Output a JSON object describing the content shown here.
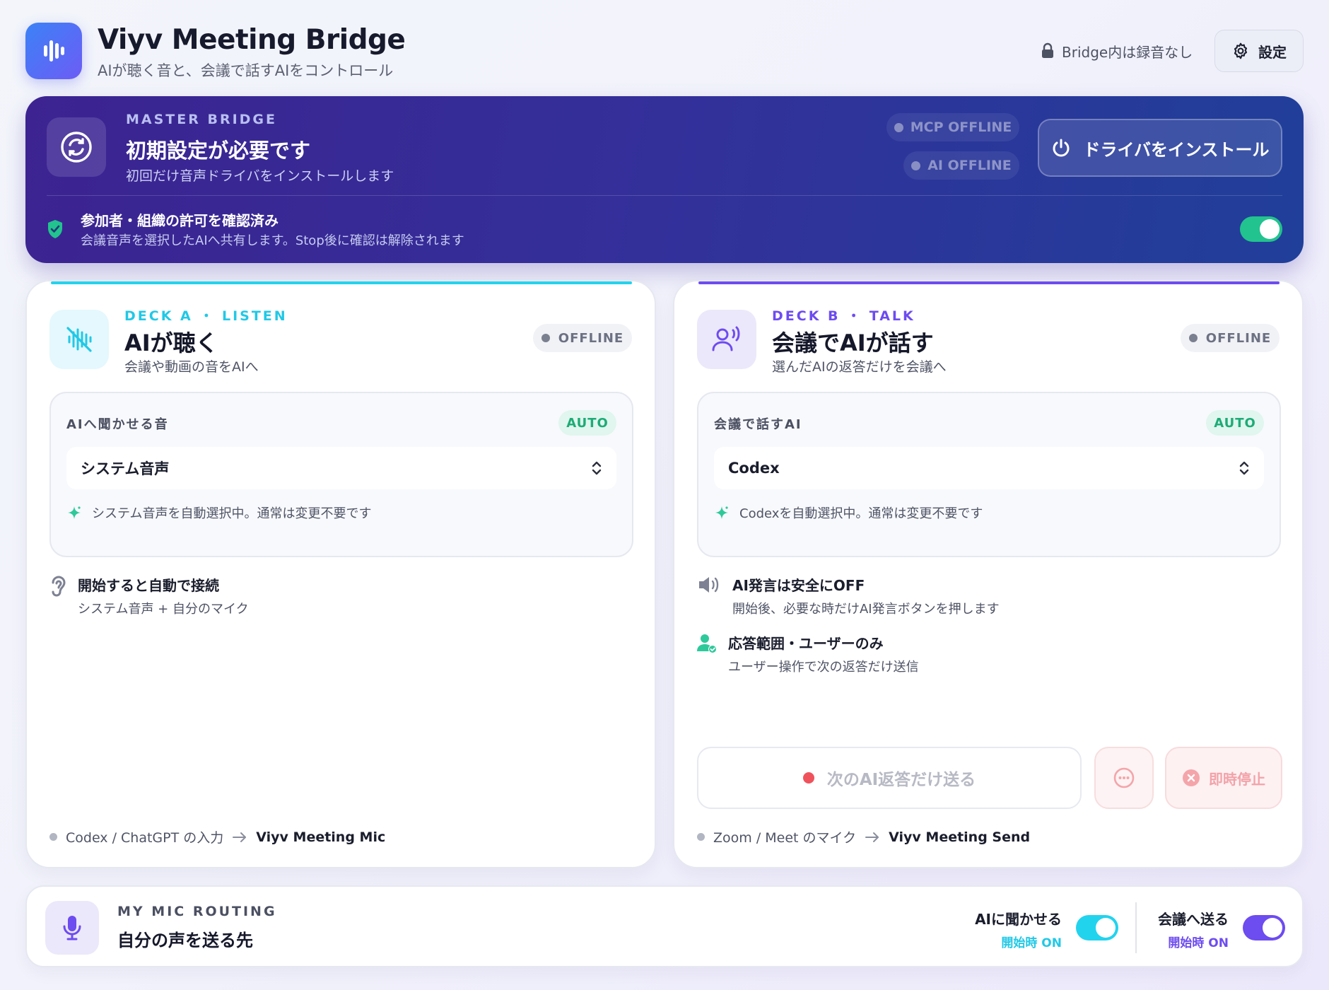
{
  "app": {
    "title": "Viyv Meeting Bridge",
    "subtitle": "AIが聴く音と、会議で話すAIをコントロール",
    "privacy_note": "Bridge内は録音なし",
    "settings_label": "設定"
  },
  "master": {
    "label": "MASTER BRIDGE",
    "title": "初期設定が必要です",
    "subtitle": "初回だけ音声ドライバをインストールします",
    "mcp_status": "MCP OFFLINE",
    "ai_status": "AI OFFLINE",
    "install_label": "ドライバをインストール",
    "consent_title": "参加者・組織の許可を確認済み",
    "consent_sub": "会議音声を選択したAIへ共有します。Stop後に確認は解除されます",
    "consent_on": true
  },
  "deck_a": {
    "label": "DECK A ・ LISTEN",
    "title": "AIが聴く",
    "subtitle": "会議や動画の音をAIへ",
    "status": "OFFLINE",
    "select_label": "AIへ聞かせる音",
    "auto_badge": "AUTO",
    "selected": "システム音声",
    "auto_note": "システム音声を自動選択中。通常は変更不要です",
    "info_title": "開始すると自動で接続",
    "info_sub": "システム音声 + 自分のマイク",
    "route_source": "Codex / ChatGPT の入力",
    "route_dest": "Viyv Meeting Mic",
    "accent": "#22d3ee"
  },
  "deck_b": {
    "label": "DECK B ・ TALK",
    "title": "会議でAIが話す",
    "subtitle": "選んだAIの返答だけを会議へ",
    "status": "OFFLINE",
    "select_label": "会議で話すAI",
    "auto_badge": "AUTO",
    "selected": "Codex",
    "auto_note": "Codexを自動選択中。通常は変更不要です",
    "info1_title": "AI発言は安全にOFF",
    "info1_sub": "開始後、必要な時だけAI発言ボタンを押します",
    "info2_title": "応答範囲・ユーザーのみ",
    "info2_sub": "ユーザー操作で次の返答だけ送信",
    "send_label": "次のAI返答だけ送る",
    "stop_label": "即時停止",
    "route_source": "Zoom / Meet のマイク",
    "route_dest": "Viyv Meeting Send",
    "accent": "#6d4cf0"
  },
  "mic_routing": {
    "label": "MY MIC ROUTING",
    "title": "自分の声を送る先",
    "opt1_label": "AIに聞かせる",
    "opt1_sub": "開始時 ON",
    "opt1_on": true,
    "opt2_label": "会議へ送る",
    "opt2_sub": "開始時 ON",
    "opt2_on": true
  },
  "colors": {
    "cyan": "#22d3ee",
    "purple": "#6d4cf0",
    "green": "#22c38e",
    "red": "#f0525c"
  }
}
